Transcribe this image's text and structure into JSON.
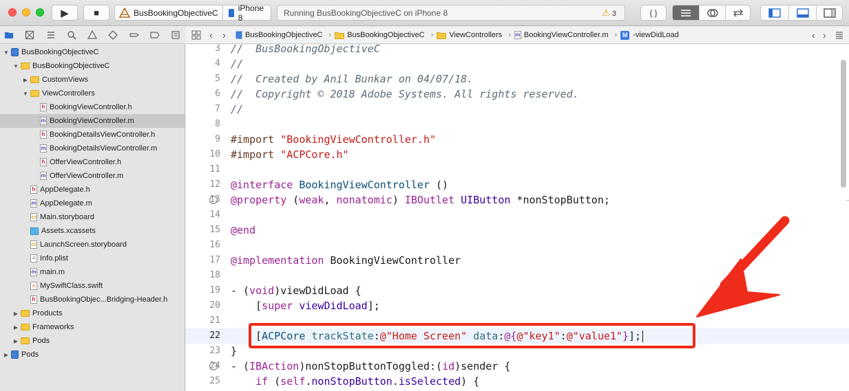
{
  "toolbar": {
    "run_label": "▶",
    "stop_label": "■",
    "scheme_name": "BusBookingObjectiveC",
    "device_name": "iPhone 8",
    "status_text": "Running BusBookingObjectiveC on iPhone 8",
    "warning_count": "3",
    "library_label": "{ }"
  },
  "jump_bar": {
    "crumbs": [
      "BusBookingObjectiveC",
      "BusBookingObjectiveC",
      "ViewControllers",
      "BookingViewController.m",
      "-viewDidLoad"
    ]
  },
  "navigator": {
    "items": [
      {
        "label": "BusBookingObjectiveC",
        "kind": "project",
        "expanded": true
      },
      {
        "label": "BusBookingObjectiveC",
        "kind": "folder",
        "expanded": true
      },
      {
        "label": "CustomViews",
        "kind": "folder",
        "expanded": false
      },
      {
        "label": "ViewControllers",
        "kind": "folder",
        "expanded": true
      },
      {
        "label": "BookingViewController.h",
        "kind": "h"
      },
      {
        "label": "BookingViewController.m",
        "kind": "m",
        "selected": true
      },
      {
        "label": "BookingDetailsViewController.h",
        "kind": "h"
      },
      {
        "label": "BookingDetailsViewController.m",
        "kind": "m"
      },
      {
        "label": "OfferViewController.h",
        "kind": "h"
      },
      {
        "label": "OfferViewController.m",
        "kind": "m"
      },
      {
        "label": "AppDelegate.h",
        "kind": "h"
      },
      {
        "label": "AppDelegate.m",
        "kind": "m"
      },
      {
        "label": "Main.storyboard",
        "kind": "storyboard"
      },
      {
        "label": "Assets.xcassets",
        "kind": "assets"
      },
      {
        "label": "LaunchScreen.storyboard",
        "kind": "storyboard"
      },
      {
        "label": "Info.plist",
        "kind": "plist"
      },
      {
        "label": "main.m",
        "kind": "m"
      },
      {
        "label": "MySwiftClass.swift",
        "kind": "swift"
      },
      {
        "label": "BusBookingObjec...Bridging-Header.h",
        "kind": "h"
      },
      {
        "label": "Products",
        "kind": "folder",
        "expanded": false
      },
      {
        "label": "Frameworks",
        "kind": "folder",
        "expanded": false
      },
      {
        "label": "Pods",
        "kind": "folder",
        "expanded": false
      },
      {
        "label": "Pods",
        "kind": "project",
        "expanded": false
      }
    ]
  },
  "editor": {
    "current_line": "22",
    "lines": [
      {
        "n": "3",
        "t": [
          [
            "cm",
            "//  BusBookingObjectiveC"
          ]
        ]
      },
      {
        "n": "4",
        "t": [
          [
            "cm",
            "//"
          ]
        ]
      },
      {
        "n": "5",
        "t": [
          [
            "cm",
            "//  Created by Anil Bunkar on 04/07/18."
          ]
        ]
      },
      {
        "n": "6",
        "t": [
          [
            "cm",
            "//  Copyright © 2018 Adobe Systems. All rights reserved."
          ]
        ]
      },
      {
        "n": "7",
        "t": [
          [
            "cm",
            "//"
          ]
        ]
      },
      {
        "n": "8",
        "t": []
      },
      {
        "n": "9",
        "t": [
          [
            "pp",
            "#import "
          ],
          [
            "st",
            "\"BookingViewController.h\""
          ]
        ]
      },
      {
        "n": "10",
        "t": [
          [
            "pp",
            "#import "
          ],
          [
            "st",
            "\"ACPCore.h\""
          ]
        ]
      },
      {
        "n": "11",
        "t": []
      },
      {
        "n": "12",
        "t": [
          [
            "kw",
            "@interface "
          ],
          [
            "ty",
            "BookingViewController"
          ],
          [
            "pl",
            " ()"
          ]
        ]
      },
      {
        "n": "13",
        "bp": true,
        "t": [
          [
            "kw",
            "@property"
          ],
          [
            "pl",
            " ("
          ],
          [
            "kw",
            "weak"
          ],
          [
            "pl",
            ", "
          ],
          [
            "kw",
            "nonatomic"
          ],
          [
            "pl",
            ") "
          ],
          [
            "kw",
            "IBOutlet"
          ],
          [
            "pl",
            " "
          ],
          [
            "cl",
            "UIButton"
          ],
          [
            "pl",
            " *nonStopButton;"
          ]
        ]
      },
      {
        "n": "14",
        "t": []
      },
      {
        "n": "15",
        "t": [
          [
            "kw",
            "@end"
          ]
        ]
      },
      {
        "n": "16",
        "t": []
      },
      {
        "n": "17",
        "t": [
          [
            "kw",
            "@implementation"
          ],
          [
            "pl",
            " BookingViewController"
          ]
        ]
      },
      {
        "n": "18",
        "t": []
      },
      {
        "n": "19",
        "t": [
          [
            "pl",
            "- ("
          ],
          [
            "kw",
            "void"
          ],
          [
            "pl",
            ")viewDidLoad {"
          ]
        ]
      },
      {
        "n": "20",
        "t": [
          [
            "pl",
            "    ["
          ],
          [
            "kw",
            "super"
          ],
          [
            "pl",
            " "
          ],
          [
            "cl",
            "viewDidLoad"
          ],
          [
            "pl",
            "];"
          ]
        ]
      },
      {
        "n": "21",
        "t": []
      },
      {
        "n": "22",
        "t": [
          [
            "pl",
            "    ["
          ],
          [
            "ty",
            "ACPCore"
          ],
          [
            "pl",
            " "
          ],
          [
            "mt",
            "trackState"
          ],
          [
            "pl",
            ":"
          ],
          [
            "st",
            "@\"Home Screen\""
          ],
          [
            "pl",
            " "
          ],
          [
            "mt",
            "data"
          ],
          [
            "pl",
            ":"
          ],
          [
            "kw",
            "@{"
          ],
          [
            "st",
            "@\"key1\""
          ],
          [
            "pl",
            ":"
          ],
          [
            "st",
            "@\"value1\""
          ],
          [
            "kw",
            "}"
          ],
          [
            "pl",
            "];"
          ]
        ]
      },
      {
        "n": "23",
        "t": [
          [
            "pl",
            "}"
          ]
        ]
      },
      {
        "n": "24",
        "bp": true,
        "t": [
          [
            "pl",
            "- ("
          ],
          [
            "kw",
            "IBAction"
          ],
          [
            "pl",
            ")nonStopButtonToggled:("
          ],
          [
            "kw",
            "id"
          ],
          [
            "pl",
            ")sender {"
          ]
        ]
      },
      {
        "n": "25",
        "t": [
          [
            "pl",
            "    "
          ],
          [
            "kw",
            "if"
          ],
          [
            "pl",
            " ("
          ],
          [
            "kw",
            "self"
          ],
          [
            "pl",
            "."
          ],
          [
            "cl",
            "nonStopButton"
          ],
          [
            "pl",
            "."
          ],
          [
            "cl",
            "isSelected"
          ],
          [
            "pl",
            ") {"
          ]
        ]
      }
    ]
  },
  "colors": {
    "highlight_box": "#ef2b1b",
    "selection": "#c9c9c9"
  }
}
